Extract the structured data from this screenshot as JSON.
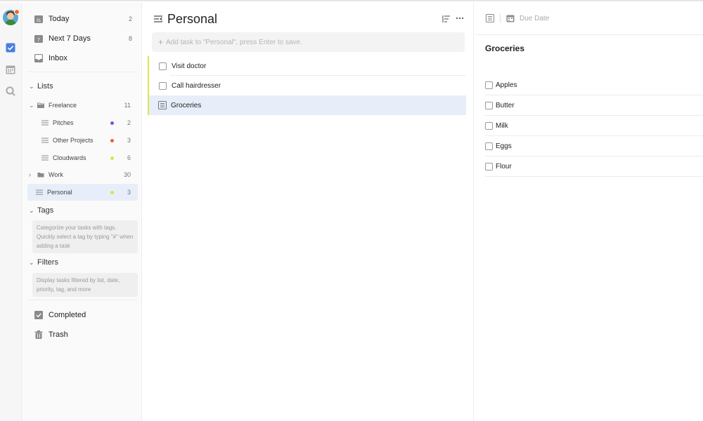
{
  "sidebar": {
    "smart_lists": [
      {
        "label": "Today",
        "count": "2",
        "icon": "calendar-today-icon"
      },
      {
        "label": "Next 7 Days",
        "count": "8",
        "icon": "calendar-week-icon"
      },
      {
        "label": "Inbox",
        "count": "",
        "icon": "inbox-icon"
      }
    ],
    "lists_heading": "Lists",
    "lists": [
      {
        "label": "Freelance",
        "count": "11",
        "icon": "folder-icon",
        "dot": ""
      },
      {
        "label": "Pitches",
        "count": "2",
        "icon": "list-icon",
        "dot": "#8e44e8"
      },
      {
        "label": "Other Projects",
        "count": "3",
        "icon": "list-icon",
        "dot": "#ef5a4a"
      },
      {
        "label": "Cloudwards",
        "count": "6",
        "icon": "list-icon",
        "dot": "#e3df4a"
      },
      {
        "label": "Work",
        "count": "30",
        "icon": "folder-icon",
        "dot": ""
      },
      {
        "label": "Personal",
        "count": "3",
        "icon": "list-icon",
        "dot": "#e3df4a"
      }
    ],
    "tags_heading": "Tags",
    "tags_hint": "Categorize your tasks with tags. Quickly select a tag by typing \"#\" when adding a task",
    "filters_heading": "Filters",
    "filters_hint": "Display tasks filtered by list, date, priority, tag, and more",
    "bottom": [
      {
        "label": "Completed",
        "icon": "completed-check-icon"
      },
      {
        "label": "Trash",
        "icon": "trash-icon"
      }
    ]
  },
  "main": {
    "title": "Personal",
    "add_placeholder": "Add task to \"Personal\", press Enter to save.",
    "tasks": [
      {
        "label": "Visit doctor"
      },
      {
        "label": "Call hairdresser"
      },
      {
        "label": "Groceries"
      }
    ]
  },
  "detail": {
    "due_label": "Due Date",
    "title": "Groceries",
    "items": [
      {
        "label": "Apples"
      },
      {
        "label": "Butter"
      },
      {
        "label": "Milk"
      },
      {
        "label": "Eggs"
      },
      {
        "label": "Flour"
      }
    ]
  },
  "colors": {
    "accent": "#4a7fe0",
    "active_bg": "#e7eef9",
    "task_border": "#dce64a"
  }
}
